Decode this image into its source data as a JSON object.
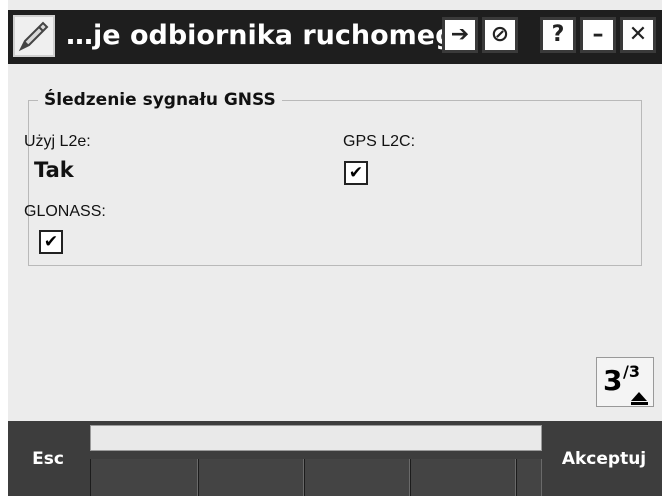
{
  "window": {
    "title": "…je odbiornika ruchomego",
    "icon": "app-pen-icon",
    "buttons": [
      {
        "name": "forward-icon",
        "glyph": "➔"
      },
      {
        "name": "no-entry-icon",
        "glyph": "⊘"
      },
      {
        "name": "help-icon",
        "glyph": "?"
      },
      {
        "name": "minimize-icon",
        "glyph": "–"
      },
      {
        "name": "close-icon",
        "glyph": "✕"
      }
    ]
  },
  "group": {
    "title": "Śledzenie sygnału GNSS",
    "fields": {
      "use_l2e_label": "Użyj L2e:",
      "use_l2e_value": "Tak",
      "gps_l2c_label": "GPS L2C:",
      "gps_l2c_checked": true,
      "glonass_label": "GLONASS:",
      "glonass_checked": true
    }
  },
  "pager": {
    "current": "3",
    "total": "3"
  },
  "bottom_bar": {
    "esc_label": "Esc",
    "accept_label": "Akceptuj",
    "entry_value": "",
    "softkeys": [
      "",
      "",
      "",
      "",
      ""
    ]
  },
  "colors": {
    "title_bar": "#1e1e1e",
    "bottom_bar": "#3d3d3d",
    "background": "#ececec"
  }
}
